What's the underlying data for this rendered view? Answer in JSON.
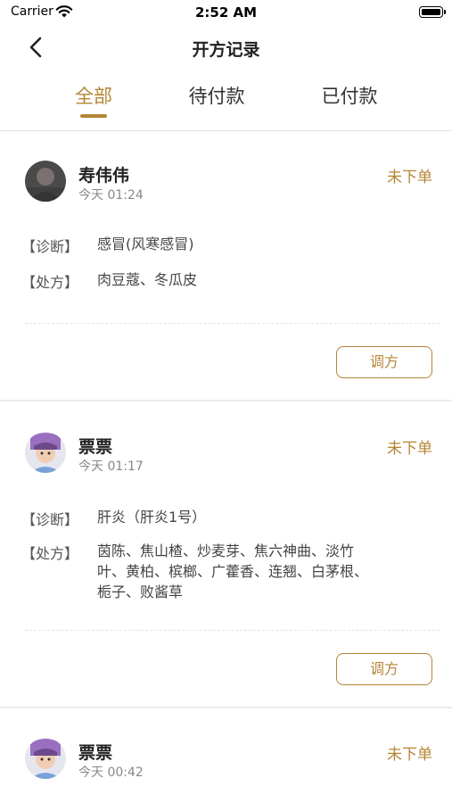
{
  "status_bar": {
    "carrier": "Carrier",
    "time": "2:52 AM"
  },
  "nav": {
    "title": "开方记录"
  },
  "tabs": [
    {
      "label": "全部",
      "active": true
    },
    {
      "label": "待付款",
      "active": false
    },
    {
      "label": "已付款",
      "active": false
    }
  ],
  "records": [
    {
      "name": "寿伟伟",
      "time": "今天 01:24",
      "status": "未下单",
      "diagnosis_label": "【诊断】",
      "diagnosis": "感冒(风寒感冒)",
      "prescription_label": "【处方】",
      "prescription": "肉豆蔻、冬瓜皮",
      "action": "调方"
    },
    {
      "name": "票票",
      "time": "今天 01:17",
      "status": "未下单",
      "diagnosis_label": "【诊断】",
      "diagnosis": "肝炎（肝炎1号）",
      "prescription_label": "【处方】",
      "prescription_lines": [
        "茵陈、焦山楂、炒麦芽、焦六神曲、淡竹",
        "叶、黄柏、槟榔、广藿香、连翘、白茅根、",
        "栀子、败酱草"
      ],
      "action": "调方"
    },
    {
      "name": "票票",
      "time": "今天 00:42",
      "status": "未下单"
    }
  ],
  "colors": {
    "accent": "#b58535"
  }
}
